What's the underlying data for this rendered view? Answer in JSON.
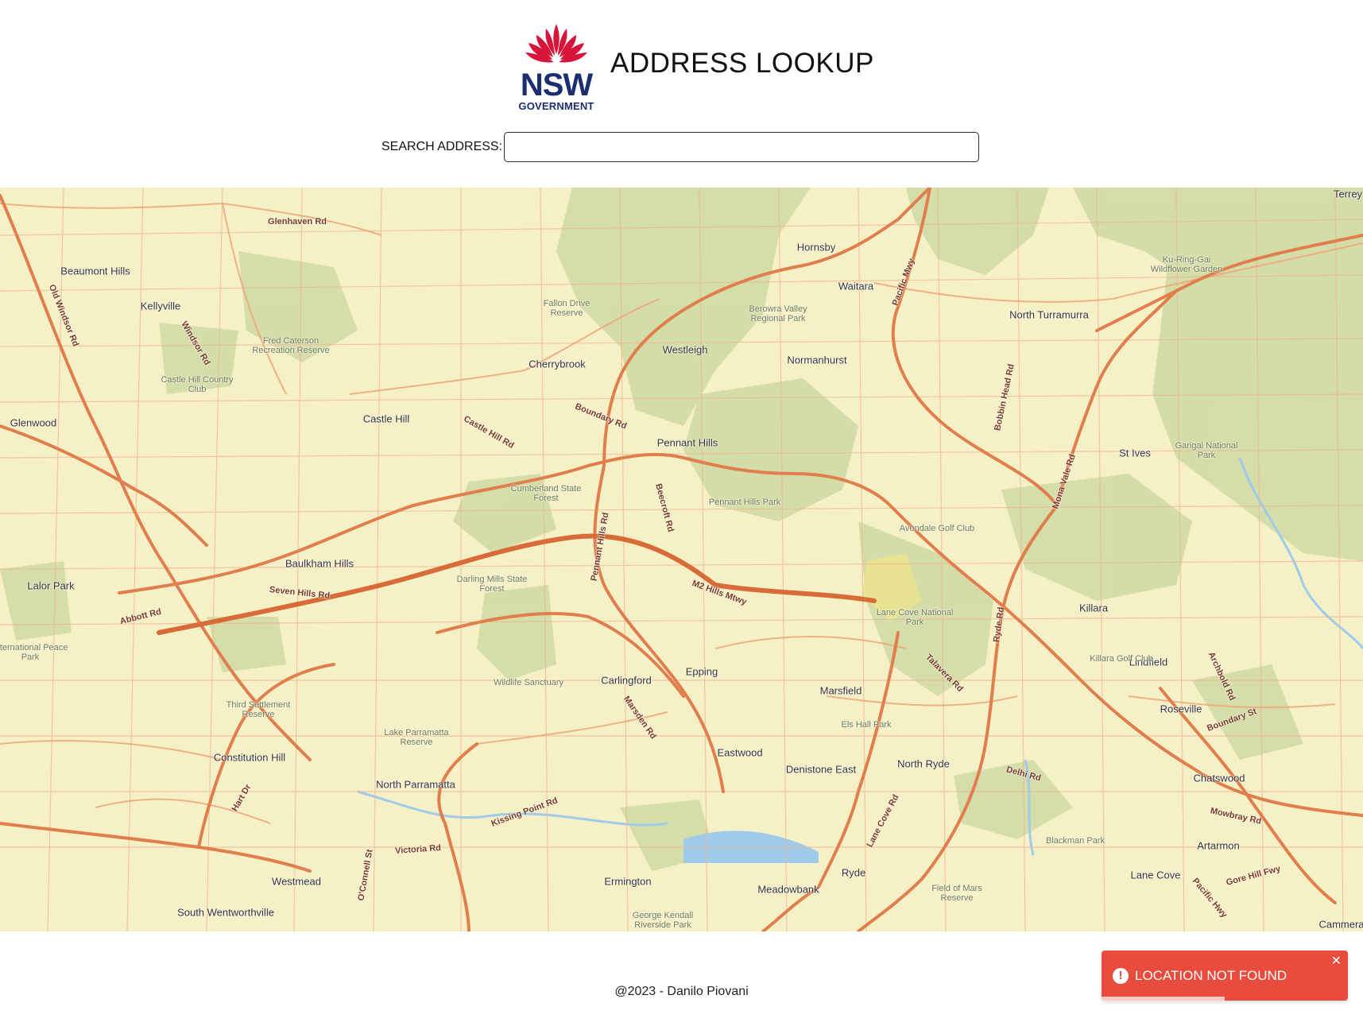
{
  "header": {
    "logo": {
      "nsw": "NSW",
      "government": "GOVERNMENT"
    },
    "title": "ADDRESS LOOKUP"
  },
  "search": {
    "label": "SEARCH ADDRESS:",
    "value": "",
    "placeholder": ""
  },
  "map": {
    "suburbs": [
      "Beaumont Hills",
      "Kellyville",
      "Glenwood",
      "Castle Hill",
      "Cherrybrook",
      "Westleigh",
      "Hornsby",
      "Waitara",
      "Normanhurst",
      "North Turramurra",
      "Pennant Hills",
      "St Ives",
      "Baulkham Hills",
      "Lalor Park",
      "Carlingford",
      "Epping",
      "Marsfield",
      "Eastwood",
      "Denistone East",
      "North Ryde",
      "Killara",
      "Lindfield",
      "Roseville",
      "Chatswood",
      "Artarmon",
      "Lane Cove",
      "Ryde",
      "Meadowbank",
      "Ermington",
      "North Parramatta",
      "Constitution Hill",
      "Westmead",
      "South Wentworthville",
      "Terrey",
      "Cammera"
    ],
    "parks": [
      "Fallon Drive Reserve",
      "Berowra Valley Regional Park",
      "Fred Caterson Recreation Reserve",
      "Castle Hill Country Club",
      "Cumberland State Forest",
      "Pennant Hills Park",
      "Avondale Golf Club",
      "Garigal National Park",
      "Ku-Ring-Gai Wildflower Garden",
      "Darling Mills State Forest",
      "Lane Cove National Park",
      "Wildlife Sanctuary",
      "Third Settlement Reserve",
      "Lake Parramatta Reserve",
      "Killara Golf Club",
      "Els Hall Park",
      "Field of Mars Reserve",
      "George Kendall Riverside Park",
      "Blackman Park",
      "International Peace Park"
    ],
    "roads": [
      "Glenhaven Rd",
      "Old Windsor Rd",
      "Windsor Rd",
      "Castle Hill Rd",
      "Boundary Rd",
      "Pacific Mwy",
      "Bobbin Head Rd",
      "Mona Vale Rd",
      "Beecroft Rd",
      "Pennant Hills Rd",
      "M2 Hills Mtwy",
      "Seven Hills Rd",
      "Abbott Rd",
      "Marsden Rd",
      "Kissing Point Rd",
      "Victoria Rd",
      "Lane Cove Rd",
      "Ryde Rd",
      "Delhi Rd",
      "Gore Hill Fwy",
      "Pacific Hwy",
      "Archbold Rd",
      "Boundary St",
      "Mowbray Rd",
      "Hart Dr",
      "O'Connell St",
      "Talavera Rd"
    ],
    "colors": {
      "land": "#f6f0c6",
      "park": "#c9d59a",
      "major_road": "#e07e4d",
      "minor_road": "#f1b793",
      "water": "#aad3f0"
    }
  },
  "footer": {
    "text": "@2023 - Danilo Piovani"
  },
  "toast": {
    "message": "LOCATION NOT FOUND",
    "icon": "alert-circle-icon",
    "close": "✕",
    "progress": 0.5,
    "color": "#e74c3c"
  }
}
